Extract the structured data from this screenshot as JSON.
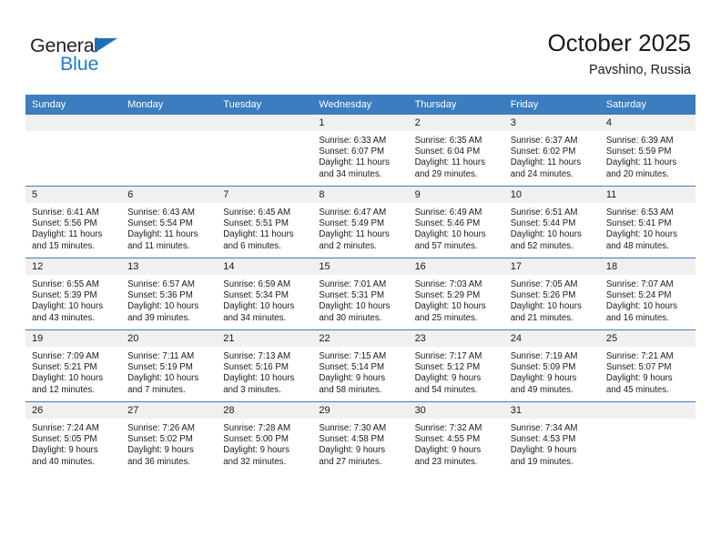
{
  "brand": {
    "name_top": "General",
    "name_bottom": "Blue",
    "triangle_color": "#1f6fb5",
    "blue_color": "#1f7fd0"
  },
  "header": {
    "title": "October 2025",
    "subtitle": "Pavshino, Russia"
  },
  "theme": {
    "header_bg": "#3b7dbf",
    "daynum_bg": "#f0f0f0",
    "row_line": "#3b7dbf",
    "text": "#1a1a1a"
  },
  "weekday_headers": [
    "Sunday",
    "Monday",
    "Tuesday",
    "Wednesday",
    "Thursday",
    "Friday",
    "Saturday"
  ],
  "labels": {
    "sunrise": "Sunrise:",
    "sunset": "Sunset:",
    "daylight": "Daylight:"
  },
  "weeks": [
    [
      {
        "day": "",
        "empty": true
      },
      {
        "day": "",
        "empty": true
      },
      {
        "day": "",
        "empty": true
      },
      {
        "day": "1",
        "sunrise": "Sunrise: 6:33 AM",
        "sunset": "Sunset: 6:07 PM",
        "daylight1": "Daylight: 11 hours",
        "daylight2": "and 34 minutes."
      },
      {
        "day": "2",
        "sunrise": "Sunrise: 6:35 AM",
        "sunset": "Sunset: 6:04 PM",
        "daylight1": "Daylight: 11 hours",
        "daylight2": "and 29 minutes."
      },
      {
        "day": "3",
        "sunrise": "Sunrise: 6:37 AM",
        "sunset": "Sunset: 6:02 PM",
        "daylight1": "Daylight: 11 hours",
        "daylight2": "and 24 minutes."
      },
      {
        "day": "4",
        "sunrise": "Sunrise: 6:39 AM",
        "sunset": "Sunset: 5:59 PM",
        "daylight1": "Daylight: 11 hours",
        "daylight2": "and 20 minutes."
      }
    ],
    [
      {
        "day": "5",
        "sunrise": "Sunrise: 6:41 AM",
        "sunset": "Sunset: 5:56 PM",
        "daylight1": "Daylight: 11 hours",
        "daylight2": "and 15 minutes."
      },
      {
        "day": "6",
        "sunrise": "Sunrise: 6:43 AM",
        "sunset": "Sunset: 5:54 PM",
        "daylight1": "Daylight: 11 hours",
        "daylight2": "and 11 minutes."
      },
      {
        "day": "7",
        "sunrise": "Sunrise: 6:45 AM",
        "sunset": "Sunset: 5:51 PM",
        "daylight1": "Daylight: 11 hours",
        "daylight2": "and 6 minutes."
      },
      {
        "day": "8",
        "sunrise": "Sunrise: 6:47 AM",
        "sunset": "Sunset: 5:49 PM",
        "daylight1": "Daylight: 11 hours",
        "daylight2": "and 2 minutes."
      },
      {
        "day": "9",
        "sunrise": "Sunrise: 6:49 AM",
        "sunset": "Sunset: 5:46 PM",
        "daylight1": "Daylight: 10 hours",
        "daylight2": "and 57 minutes."
      },
      {
        "day": "10",
        "sunrise": "Sunrise: 6:51 AM",
        "sunset": "Sunset: 5:44 PM",
        "daylight1": "Daylight: 10 hours",
        "daylight2": "and 52 minutes."
      },
      {
        "day": "11",
        "sunrise": "Sunrise: 6:53 AM",
        "sunset": "Sunset: 5:41 PM",
        "daylight1": "Daylight: 10 hours",
        "daylight2": "and 48 minutes."
      }
    ],
    [
      {
        "day": "12",
        "sunrise": "Sunrise: 6:55 AM",
        "sunset": "Sunset: 5:39 PM",
        "daylight1": "Daylight: 10 hours",
        "daylight2": "and 43 minutes."
      },
      {
        "day": "13",
        "sunrise": "Sunrise: 6:57 AM",
        "sunset": "Sunset: 5:36 PM",
        "daylight1": "Daylight: 10 hours",
        "daylight2": "and 39 minutes."
      },
      {
        "day": "14",
        "sunrise": "Sunrise: 6:59 AM",
        "sunset": "Sunset: 5:34 PM",
        "daylight1": "Daylight: 10 hours",
        "daylight2": "and 34 minutes."
      },
      {
        "day": "15",
        "sunrise": "Sunrise: 7:01 AM",
        "sunset": "Sunset: 5:31 PM",
        "daylight1": "Daylight: 10 hours",
        "daylight2": "and 30 minutes."
      },
      {
        "day": "16",
        "sunrise": "Sunrise: 7:03 AM",
        "sunset": "Sunset: 5:29 PM",
        "daylight1": "Daylight: 10 hours",
        "daylight2": "and 25 minutes."
      },
      {
        "day": "17",
        "sunrise": "Sunrise: 7:05 AM",
        "sunset": "Sunset: 5:26 PM",
        "daylight1": "Daylight: 10 hours",
        "daylight2": "and 21 minutes."
      },
      {
        "day": "18",
        "sunrise": "Sunrise: 7:07 AM",
        "sunset": "Sunset: 5:24 PM",
        "daylight1": "Daylight: 10 hours",
        "daylight2": "and 16 minutes."
      }
    ],
    [
      {
        "day": "19",
        "sunrise": "Sunrise: 7:09 AM",
        "sunset": "Sunset: 5:21 PM",
        "daylight1": "Daylight: 10 hours",
        "daylight2": "and 12 minutes."
      },
      {
        "day": "20",
        "sunrise": "Sunrise: 7:11 AM",
        "sunset": "Sunset: 5:19 PM",
        "daylight1": "Daylight: 10 hours",
        "daylight2": "and 7 minutes."
      },
      {
        "day": "21",
        "sunrise": "Sunrise: 7:13 AM",
        "sunset": "Sunset: 5:16 PM",
        "daylight1": "Daylight: 10 hours",
        "daylight2": "and 3 minutes."
      },
      {
        "day": "22",
        "sunrise": "Sunrise: 7:15 AM",
        "sunset": "Sunset: 5:14 PM",
        "daylight1": "Daylight: 9 hours",
        "daylight2": "and 58 minutes."
      },
      {
        "day": "23",
        "sunrise": "Sunrise: 7:17 AM",
        "sunset": "Sunset: 5:12 PM",
        "daylight1": "Daylight: 9 hours",
        "daylight2": "and 54 minutes."
      },
      {
        "day": "24",
        "sunrise": "Sunrise: 7:19 AM",
        "sunset": "Sunset: 5:09 PM",
        "daylight1": "Daylight: 9 hours",
        "daylight2": "and 49 minutes."
      },
      {
        "day": "25",
        "sunrise": "Sunrise: 7:21 AM",
        "sunset": "Sunset: 5:07 PM",
        "daylight1": "Daylight: 9 hours",
        "daylight2": "and 45 minutes."
      }
    ],
    [
      {
        "day": "26",
        "sunrise": "Sunrise: 7:24 AM",
        "sunset": "Sunset: 5:05 PM",
        "daylight1": "Daylight: 9 hours",
        "daylight2": "and 40 minutes."
      },
      {
        "day": "27",
        "sunrise": "Sunrise: 7:26 AM",
        "sunset": "Sunset: 5:02 PM",
        "daylight1": "Daylight: 9 hours",
        "daylight2": "and 36 minutes."
      },
      {
        "day": "28",
        "sunrise": "Sunrise: 7:28 AM",
        "sunset": "Sunset: 5:00 PM",
        "daylight1": "Daylight: 9 hours",
        "daylight2": "and 32 minutes."
      },
      {
        "day": "29",
        "sunrise": "Sunrise: 7:30 AM",
        "sunset": "Sunset: 4:58 PM",
        "daylight1": "Daylight: 9 hours",
        "daylight2": "and 27 minutes."
      },
      {
        "day": "30",
        "sunrise": "Sunrise: 7:32 AM",
        "sunset": "Sunset: 4:55 PM",
        "daylight1": "Daylight: 9 hours",
        "daylight2": "and 23 minutes."
      },
      {
        "day": "31",
        "sunrise": "Sunrise: 7:34 AM",
        "sunset": "Sunset: 4:53 PM",
        "daylight1": "Daylight: 9 hours",
        "daylight2": "and 19 minutes."
      },
      {
        "day": "",
        "empty": true
      }
    ]
  ]
}
